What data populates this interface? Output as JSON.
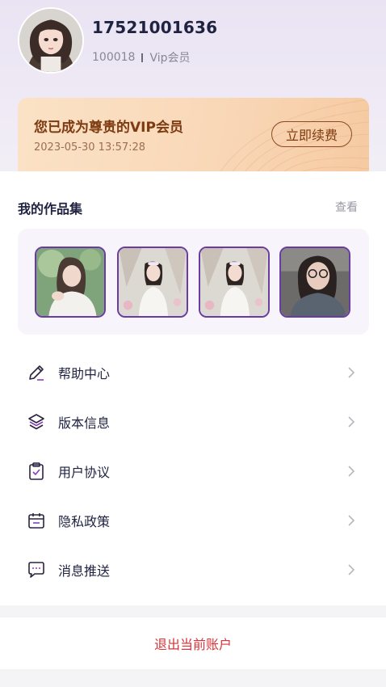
{
  "profile": {
    "phone": "17521001636",
    "user_id": "100018",
    "level": "Vip会员"
  },
  "vip_card": {
    "title": "您已成为尊贵的VIP会员",
    "expire": "2023-05-30 13:57:28",
    "renew_label": "立即续费",
    "colors": {
      "card_start": "#fbe2c6",
      "card_end": "#f6caa2",
      "text": "#7d3b12"
    }
  },
  "works": {
    "title": "我的作品集",
    "view_label": "查看",
    "thumbnails": [
      "portrait-girl-sitting",
      "portrait-girl-white-dress",
      "portrait-girl-white-dress",
      "portrait-woman-glasses"
    ]
  },
  "menu": [
    {
      "label": "帮助中心",
      "icon": "pencil-icon"
    },
    {
      "label": "版本信息",
      "icon": "layers-icon"
    },
    {
      "label": "用户协议",
      "icon": "clipboard-check-icon"
    },
    {
      "label": "隐私政策",
      "icon": "calendar-icon"
    },
    {
      "label": "消息推送",
      "icon": "chat-bubble-icon"
    }
  ],
  "logout_label": "退出当前账户",
  "colors": {
    "accent": "#6a3ca3",
    "logout": "#d9343a",
    "title": "#1f2240"
  }
}
